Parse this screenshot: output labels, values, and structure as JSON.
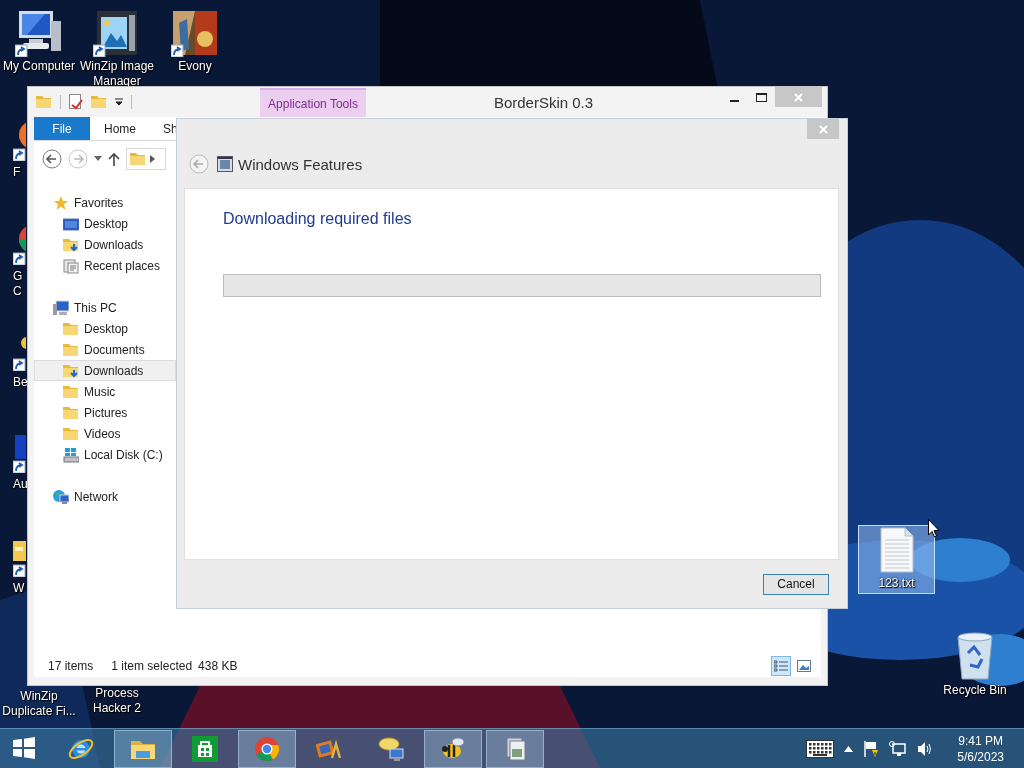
{
  "desktop": {
    "icons": [
      {
        "label": "My Computer",
        "selected": false
      },
      {
        "label": "WinZip Image Manager",
        "selected": false
      },
      {
        "label": "Evony",
        "selected": false
      },
      {
        "label": "F",
        "selected": false
      },
      {
        "label": "G C",
        "selected": false
      },
      {
        "label": "Be",
        "selected": false
      },
      {
        "label": "Au",
        "selected": false
      },
      {
        "label": "W",
        "selected": false
      },
      {
        "label": "WinZip Duplicate Fi...",
        "selected": false
      },
      {
        "label": "Process Hacker 2",
        "selected": false
      },
      {
        "label": "123.txt",
        "selected": true
      },
      {
        "label": "Recycle Bin",
        "selected": false
      }
    ]
  },
  "explorer": {
    "title": "BorderSkin 0.3",
    "context_tab": "Application Tools",
    "ribbon_tabs": [
      {
        "label": "File",
        "kind": "file"
      },
      {
        "label": "Home",
        "kind": "tab"
      },
      {
        "label": "Sh",
        "kind": "tab"
      }
    ],
    "nav_pane": [
      {
        "label": "Favorites",
        "selected": false,
        "children": [
          {
            "label": "Desktop",
            "selected": false
          },
          {
            "label": "Downloads",
            "selected": false
          },
          {
            "label": "Recent places",
            "selected": false
          }
        ]
      },
      {
        "label": "This PC",
        "selected": false,
        "children": [
          {
            "label": "Desktop",
            "selected": false
          },
          {
            "label": "Documents",
            "selected": false
          },
          {
            "label": "Downloads",
            "selected": true
          },
          {
            "label": "Music",
            "selected": false
          },
          {
            "label": "Pictures",
            "selected": false
          },
          {
            "label": "Videos",
            "selected": false
          },
          {
            "label": "Local Disk (C:)",
            "selected": false
          }
        ]
      },
      {
        "label": "Network",
        "selected": false
      }
    ],
    "status_bar": {
      "item_count": "17 items",
      "selection": "1 item selected",
      "size": "438 KB"
    },
    "view_buttons": [
      {
        "selected": true
      },
      {
        "selected": false
      }
    ]
  },
  "dialog": {
    "title": "Windows Features",
    "heading": "Downloading required files",
    "buttons": [
      "Cancel"
    ]
  },
  "taskbar": {
    "buttons": [
      {
        "running": false
      },
      {
        "running": false
      },
      {
        "running": true
      },
      {
        "running": false
      },
      {
        "running": true
      },
      {
        "running": false
      },
      {
        "running": false
      },
      {
        "running": true
      },
      {
        "running": true
      }
    ],
    "clock": {
      "time": "9:41 PM",
      "date": "5/6/2023"
    }
  }
}
